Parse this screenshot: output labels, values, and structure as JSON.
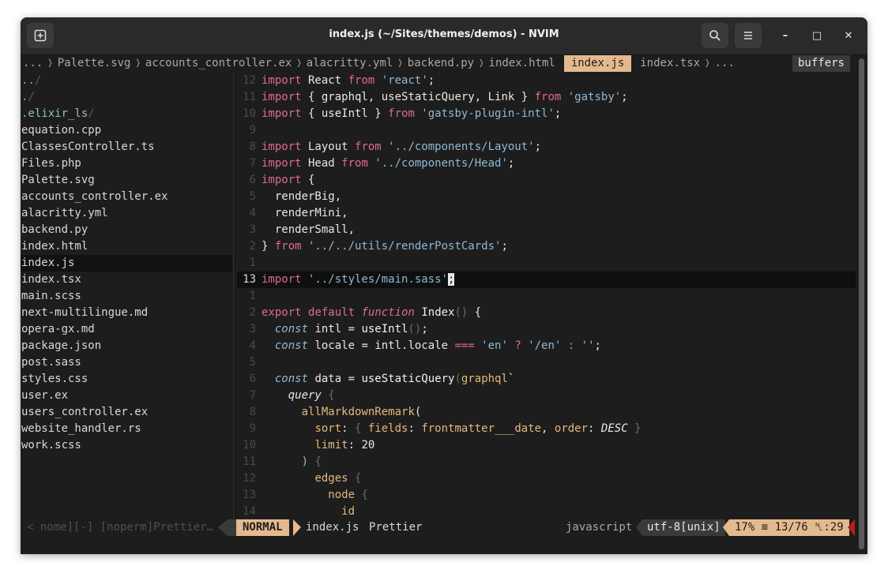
{
  "window": {
    "title": "index.js (~/Sites/themes/demos) - NVIM",
    "new_tab_icon": "new-tab-icon",
    "search_icon": "search-icon",
    "menu_icon": "hamburger-menu-icon",
    "minimize": "–",
    "maximize": "□",
    "close": "✕"
  },
  "tabline": {
    "tabs": [
      "...",
      "Palette.svg",
      "accounts_controller.ex",
      "alacritty.yml",
      "backend.py",
      "index.html",
      "index.js",
      "index.tsx",
      "..."
    ],
    "active": "index.js",
    "buffers_label": "buffers"
  },
  "tree": {
    "items": [
      {
        "name": "..",
        "type": "dir"
      },
      {
        "name": ".",
        "type": "dir"
      },
      {
        "name": ".elixir_ls",
        "type": "hl"
      },
      {
        "name": "equation.cpp",
        "type": "file"
      },
      {
        "name": "ClassesController.ts",
        "type": "file"
      },
      {
        "name": "Files.php",
        "type": "file"
      },
      {
        "name": "Palette.svg",
        "type": "file"
      },
      {
        "name": "accounts_controller.ex",
        "type": "file"
      },
      {
        "name": "alacritty.yml",
        "type": "file"
      },
      {
        "name": "backend.py",
        "type": "file"
      },
      {
        "name": "index.html",
        "type": "file"
      },
      {
        "name": "index.js",
        "type": "sel"
      },
      {
        "name": "index.tsx",
        "type": "file"
      },
      {
        "name": "main.scss",
        "type": "file"
      },
      {
        "name": "next-multilingue.md",
        "type": "file"
      },
      {
        "name": "opera-gx.md",
        "type": "file"
      },
      {
        "name": "package.json",
        "type": "file"
      },
      {
        "name": "post.sass",
        "type": "file"
      },
      {
        "name": "styles.css",
        "type": "file"
      },
      {
        "name": "user.ex",
        "type": "file"
      },
      {
        "name": "users_controller.ex",
        "type": "file"
      },
      {
        "name": "website_handler.rs",
        "type": "file"
      },
      {
        "name": "work.scss",
        "type": "file"
      }
    ]
  },
  "code": {
    "lines": [
      {
        "n": "12",
        "segs": [
          [
            "import",
            "kw"
          ],
          [
            " React ",
            "id"
          ],
          [
            "from",
            "kw"
          ],
          [
            " 'react'",
            "str"
          ],
          [
            ";",
            "id"
          ]
        ]
      },
      {
        "n": "11",
        "segs": [
          [
            "import",
            "kw"
          ],
          [
            " { graphql, useStaticQuery, Link } ",
            "id"
          ],
          [
            "from",
            "kw"
          ],
          [
            " 'gatsby'",
            "str"
          ],
          [
            ";",
            "id"
          ]
        ]
      },
      {
        "n": "10",
        "segs": [
          [
            "import",
            "kw"
          ],
          [
            " { useIntl } ",
            "id"
          ],
          [
            "from",
            "kw"
          ],
          [
            " 'gatsby-plugin-intl'",
            "str"
          ],
          [
            ";",
            "id"
          ]
        ]
      },
      {
        "n": "9",
        "segs": []
      },
      {
        "n": "8",
        "segs": [
          [
            "import",
            "kw"
          ],
          [
            " Layout ",
            "id"
          ],
          [
            "from",
            "kw"
          ],
          [
            " '../components/Layout'",
            "str"
          ],
          [
            ";",
            "id"
          ]
        ]
      },
      {
        "n": "7",
        "segs": [
          [
            "import",
            "kw"
          ],
          [
            " Head ",
            "id"
          ],
          [
            "from",
            "kw"
          ],
          [
            " '../components/Head'",
            "str"
          ],
          [
            ";",
            "id"
          ]
        ]
      },
      {
        "n": "6",
        "segs": [
          [
            "import",
            "kw"
          ],
          [
            " {",
            "id"
          ]
        ]
      },
      {
        "n": "5",
        "segs": [
          [
            "  renderBig,",
            "id"
          ]
        ]
      },
      {
        "n": "4",
        "segs": [
          [
            "  renderMini,",
            "id"
          ]
        ]
      },
      {
        "n": "3",
        "segs": [
          [
            "  renderSmall,",
            "id"
          ]
        ]
      },
      {
        "n": "2",
        "segs": [
          [
            "} ",
            "id"
          ],
          [
            "from",
            "kw"
          ],
          [
            " '../../utils/renderPostCards'",
            "str"
          ],
          [
            ";",
            "id"
          ]
        ]
      },
      {
        "n": "1",
        "segs": []
      },
      {
        "n": "13",
        "segs": [
          [
            "import",
            "kw"
          ],
          [
            " '../styles/main.sass'",
            "str"
          ],
          [
            ";",
            "cursor"
          ]
        ],
        "current": true
      },
      {
        "n": "1",
        "segs": []
      },
      {
        "n": "2",
        "segs": [
          [
            "export",
            "kw"
          ],
          [
            " ",
            "id"
          ],
          [
            "default",
            "kw"
          ],
          [
            " ",
            "id"
          ],
          [
            "function",
            "func"
          ],
          [
            " Index",
            "fn"
          ],
          [
            "()",
            "dim"
          ],
          [
            " {",
            "id"
          ]
        ]
      },
      {
        "n": "3",
        "segs": [
          [
            "  ",
            "id"
          ],
          [
            "const",
            "ital-blue"
          ],
          [
            " intl = ",
            "id"
          ],
          [
            "useIntl",
            "fn"
          ],
          [
            "()",
            "dim"
          ],
          [
            ";",
            "id"
          ]
        ]
      },
      {
        "n": "4",
        "segs": [
          [
            "  ",
            "id"
          ],
          [
            "const",
            "ital-blue"
          ],
          [
            " locale = intl.locale ",
            "id"
          ],
          [
            "===",
            "kw"
          ],
          [
            " 'en'",
            "str"
          ],
          [
            " ? ",
            "kw"
          ],
          [
            "'/en'",
            "str"
          ],
          [
            " : ",
            "kw"
          ],
          [
            "''",
            "str"
          ],
          [
            ";",
            "id"
          ]
        ]
      },
      {
        "n": "5",
        "segs": []
      },
      {
        "n": "6",
        "segs": [
          [
            "  ",
            "id"
          ],
          [
            "const",
            "ital-blue"
          ],
          [
            " data = ",
            "id"
          ],
          [
            "useStaticQuery",
            "fn"
          ],
          [
            "(",
            "dim"
          ],
          [
            "graphql",
            "gql"
          ],
          [
            "`",
            "id"
          ]
        ]
      },
      {
        "n": "7",
        "segs": [
          [
            "    ",
            "id"
          ],
          [
            "query",
            "ital"
          ],
          [
            " {",
            "dim"
          ]
        ]
      },
      {
        "n": "8",
        "segs": [
          [
            "      ",
            "id"
          ],
          [
            "allMarkdownRemark",
            "gql"
          ],
          [
            "(",
            "id"
          ]
        ]
      },
      {
        "n": "9",
        "segs": [
          [
            "        ",
            "id"
          ],
          [
            "sort",
            "gql"
          ],
          [
            ": ",
            "id"
          ],
          [
            "{ ",
            "dim"
          ],
          [
            "fields",
            "gql"
          ],
          [
            ": ",
            "id"
          ],
          [
            "frontmatter___date",
            "gql"
          ],
          [
            ", ",
            "id"
          ],
          [
            "order",
            "gql"
          ],
          [
            ": ",
            "id"
          ],
          [
            "DESC",
            "ital"
          ],
          [
            " }",
            "dim"
          ]
        ]
      },
      {
        "n": "10",
        "segs": [
          [
            "        ",
            "id"
          ],
          [
            "limit",
            "gql"
          ],
          [
            ": ",
            "id"
          ],
          [
            "20",
            "num"
          ]
        ]
      },
      {
        "n": "11",
        "segs": [
          [
            "      ) ",
            "str"
          ],
          [
            "{",
            "dim"
          ]
        ]
      },
      {
        "n": "12",
        "segs": [
          [
            "        ",
            "id"
          ],
          [
            "edges",
            "gql"
          ],
          [
            " {",
            "dim"
          ]
        ]
      },
      {
        "n": "13",
        "segs": [
          [
            "          ",
            "id"
          ],
          [
            "node",
            "gql"
          ],
          [
            " {",
            "dim"
          ]
        ]
      },
      {
        "n": "14",
        "segs": [
          [
            "            ",
            "id"
          ],
          [
            "id",
            "gql"
          ]
        ]
      }
    ]
  },
  "statusline": {
    "left": "< nome][-] [noperm]Prettier…",
    "mode": "NORMAL",
    "file": "index.js",
    "formatter": "Prettier",
    "language": "javascript",
    "encoding": "utf-8[unix]",
    "position": "17% ≡ 13/76 ␤:29"
  }
}
